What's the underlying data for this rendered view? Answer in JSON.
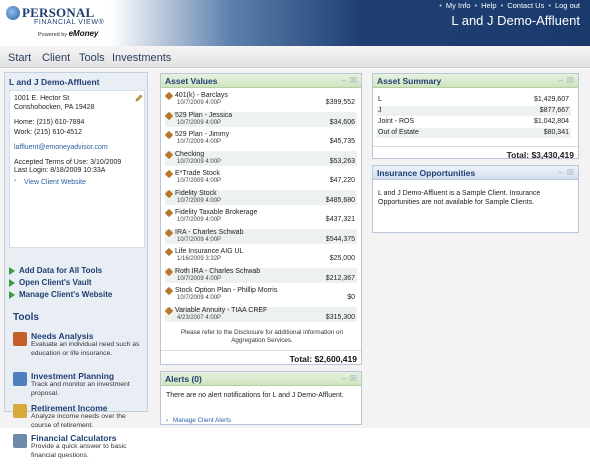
{
  "header": {
    "logo": {
      "line1": "PERSONAL",
      "line2": "FINANCIAL VIEW®",
      "line3_prefix": "Powered by",
      "line3_brand": "eMoney"
    },
    "util_links": [
      "My Info",
      "Help",
      "Contact Us",
      "Log out"
    ],
    "client_title": "L and J Demo-Affluent"
  },
  "nav": [
    "Start",
    "Client",
    "Tools",
    "Investments"
  ],
  "sidebar": {
    "title": "L and J Demo-Affluent",
    "address1": "1001 E. Hector St",
    "address2": "Conshohocken, PA 19428",
    "home": "Home:  (215) 610-7894",
    "work": "Work:  (215) 610-4512",
    "email": "laffluent@emoneyadvisor.com",
    "accepted_terms": "Accepted Terms of Use: 3/10/2009",
    "last_login": "Last Login: 8/18/2009 10:33A",
    "view_website": "View Client Website",
    "actions": [
      "Add Data for All Tools",
      "Open Client's Vault",
      "Manage Client's Website"
    ]
  },
  "tools": {
    "title": "Tools",
    "items": [
      {
        "name": "Needs Analysis",
        "desc": "Evaluate an individual need such as education or life insurance.",
        "color": "#c55f2a"
      },
      {
        "name": "Investment Planning",
        "desc": "Track and monitor an investment proposal.",
        "color": "#4f7fbf"
      },
      {
        "name": "Retirement Income",
        "desc": "Analyze income needs over the course of retirement.",
        "color": "#d6a93a"
      },
      {
        "name": "Financial Calculators",
        "desc": "Provide a quick answer to basic financial questions.",
        "color": "#6f8aa8"
      }
    ]
  },
  "asset_values": {
    "title": "Asset Values",
    "items": [
      {
        "name": "401(k) - Barclays",
        "date": "10/7/2009 4:00P",
        "value": "$399,552"
      },
      {
        "name": "529 Plan - Jessica",
        "date": "10/7/2009 4:00P",
        "value": "$34,606"
      },
      {
        "name": "529 Plan - Jimmy",
        "date": "10/7/2009 4:00P",
        "value": "$45,735"
      },
      {
        "name": "Checking",
        "date": "10/7/2009 4:00P",
        "value": "$53,263"
      },
      {
        "name": "E*Trade Stock",
        "date": "10/7/2009 4:00P",
        "value": "$47,220"
      },
      {
        "name": "Fidelity Stock",
        "date": "10/7/2009 4:00P",
        "value": "$485,680"
      },
      {
        "name": "Fidelity Taxable Brokerage",
        "date": "10/7/2009 4:00P",
        "value": "$437,321"
      },
      {
        "name": "IRA - Charles Schwab",
        "date": "10/7/2009 4:00P",
        "value": "$544,375"
      },
      {
        "name": "Life Insurance AIG UL",
        "date": "1/16/2009 3:32P",
        "value": "$25,000"
      },
      {
        "name": "Roth IRA - Charles Schwab",
        "date": "10/7/2009 4:00P",
        "value": "$212,367"
      },
      {
        "name": "Stock Option Plan - Phillip Morris",
        "date": "10/7/2009 4:00P",
        "value": "$0"
      },
      {
        "name": "Variable Annuity - TIAA CREF",
        "date": "4/23/2007 4:00P",
        "value": "$315,300"
      }
    ],
    "disclosure": "Please refer to the Disclosure for additional information on Aggregation Services.",
    "total": "Total: $2,600,419"
  },
  "asset_summary": {
    "title": "Asset Summary",
    "rows": [
      {
        "label": "L",
        "value": "$1,429,607"
      },
      {
        "label": "J",
        "value": "$877,667"
      },
      {
        "label": "Joint - ROS",
        "value": "$1,042,804"
      },
      {
        "label": "Out of Estate",
        "value": "$80,341"
      }
    ],
    "total": "Total: $3,430,419"
  },
  "insurance": {
    "title": "Insurance Opportunities",
    "text": "L and J Demo-Affluent is a Sample Client. Insurance Opportunities are not available for Sample Clients."
  },
  "alerts": {
    "title": "Alerts (0)",
    "text": "There are no alert notifications for L and J Demo-Affluent.",
    "link": "Manage Client Alerts"
  },
  "panel_icons": {
    "minimize": "–",
    "close": "☒"
  }
}
